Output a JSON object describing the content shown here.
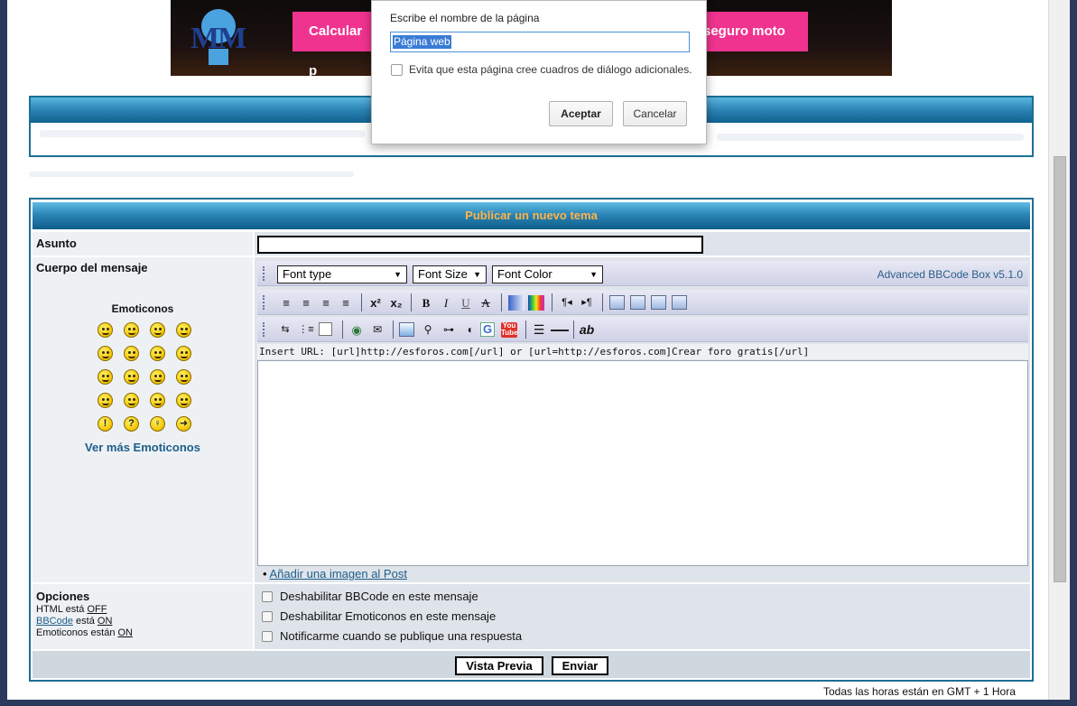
{
  "banner": {
    "logo": "MM",
    "cta_left": "Calcular p",
    "cta_right": "seguro moto"
  },
  "dialog": {
    "prompt": "Escribe el nombre de la página",
    "input_value": "Página web",
    "checkbox_label": "Evita que esta página cree cuadros de diálogo adicionales.",
    "ok": "Aceptar",
    "cancel": "Cancelar"
  },
  "post": {
    "title": "Publicar un nuevo tema",
    "subject_label": "Asunto",
    "body_label": "Cuerpo del mensaje",
    "emoticons_title": "Emoticonos",
    "more_emoticons": "Ver más Emoticonos",
    "emoticons": [
      "grin",
      "smile",
      "sad",
      "surprised",
      "confused",
      "neutral",
      "cool",
      "laugh",
      "mad",
      "razz",
      "shock",
      "worried",
      "evil",
      "twisted",
      "rolleyes",
      "wink",
      "exclaim",
      "question",
      "idea",
      "arrow"
    ],
    "editor": {
      "font_type": "Font type",
      "font_size": "Font Size",
      "font_color": "Font Color",
      "version": "Advanced BBCode Box v5.1.0",
      "hint": "Insert URL: [url]http://esforos.com[/url] or [url=http://esforos.com]Crear foro gratis[/url]",
      "add_image": "Añadir una imagen al Post"
    },
    "options": {
      "label": "Opciones",
      "html_status": "HTML está",
      "html_value": "OFF",
      "bbcode_link": "BBCode",
      "bbcode_status": " está",
      "bbcode_value": "ON",
      "emo_status": "Emoticonos están",
      "emo_value": "ON",
      "disable_bbcode": "Deshabilitar BBCode en este mensaje",
      "disable_emoticons": "Deshabilitar Emoticonos en este mensaje",
      "notify": "Notificarme cuando se publique una respuesta"
    },
    "buttons": {
      "preview": "Vista Previa",
      "send": "Enviar"
    }
  },
  "footer": "Todas las horas están en GMT + 1 Hora"
}
